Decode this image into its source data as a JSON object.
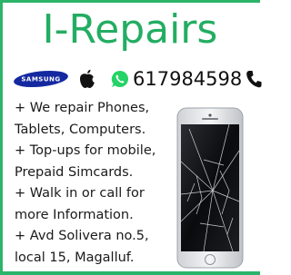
{
  "ad": {
    "title": "I-Repairs",
    "phone_number": "617984598",
    "logo_text": "SAMSUNG",
    "services": [
      {
        "line1": "+ We repair Phones,",
        "line2": "Tablets, Computers."
      },
      {
        "line1": "+ Top-ups for mobile,",
        "line2": "Prepaid Simcards."
      },
      {
        "line1": "+ Walk in or call for",
        "line2": "more Information."
      },
      {
        "line1": "+ Avd Solivera no.5,",
        "line2": "local 15, Magalluf."
      }
    ]
  },
  "colors": {
    "brand_green": "#2cb46a",
    "samsung_blue": "#1428a0",
    "whatsapp_green": "#25d366"
  },
  "icons": [
    "samsung-logo",
    "apple-icon",
    "whatsapp-icon",
    "phone-icon",
    "cracked-phone-image"
  ]
}
